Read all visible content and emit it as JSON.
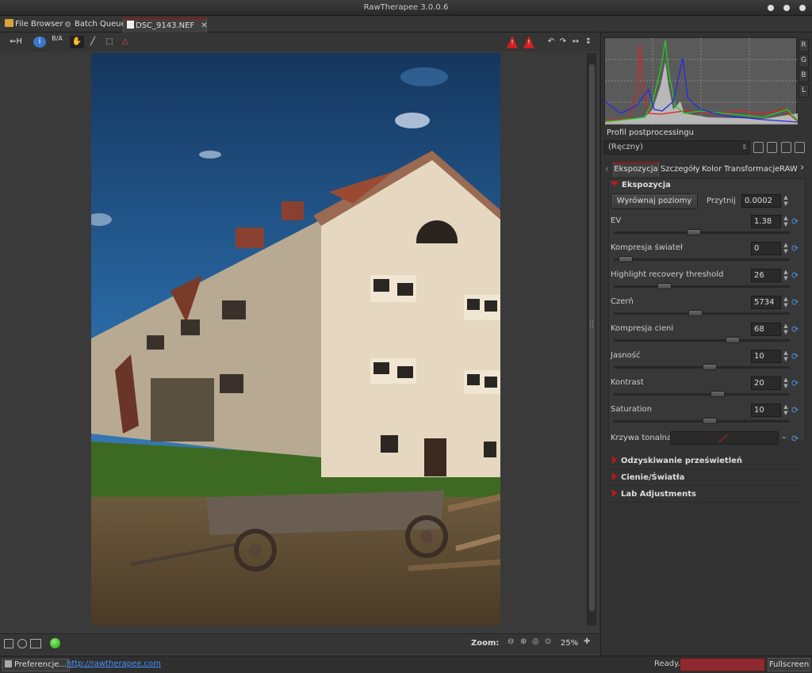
{
  "window": {
    "title": "RawTherapee 3.0.0.6"
  },
  "tabs": [
    {
      "label": "File Browser",
      "icon": "folder-icon"
    },
    {
      "label": "Batch Queue",
      "icon": "gears-icon"
    },
    {
      "label": "DSC_9143.NEF",
      "icon": "file-icon",
      "close": "✕",
      "active": true
    }
  ],
  "toolbar": {
    "history_label": "H",
    "ba_label": "B/A"
  },
  "histogram": {
    "channel_buttons": [
      "R",
      "G",
      "B",
      "L"
    ],
    "colors": {
      "red": "#e02020",
      "green": "#20d020",
      "blue": "#2020e0",
      "luma": "#d8d8d8"
    }
  },
  "profile": {
    "label": "Profil postprocessingu",
    "value": "(Ręczny)"
  },
  "panel_tabs": [
    "Ekspozycja",
    "Szczegóły",
    "Kolor",
    "Transformacje",
    "RAW"
  ],
  "exposure": {
    "title": "Ekspozycja",
    "auto_button": "Wyrównaj poziomy",
    "clip_label": "Przytnij",
    "clip_value": "0.0002",
    "sliders": [
      {
        "label": "EV",
        "value": "1.38",
        "pos": 0.45
      },
      {
        "label": "Kompresja świateł",
        "value": "0",
        "pos": 0.03
      },
      {
        "label": "Highlight recovery threshold",
        "value": "26",
        "pos": 0.27
      },
      {
        "label": "Czerń",
        "value": "5734",
        "pos": 0.46
      },
      {
        "label": "Kompresja cieni",
        "value": "68",
        "pos": 0.69
      },
      {
        "label": "Jasność",
        "value": "10",
        "pos": 0.55
      },
      {
        "label": "Kontrast",
        "value": "20",
        "pos": 0.6
      },
      {
        "label": "Saturation",
        "value": "10",
        "pos": 0.55
      }
    ],
    "curve_label": "Krzywa tonalna:"
  },
  "sections": [
    "Odzyskiwanie prześwietleń",
    "Cienie/Światła",
    "Lab Adjustments"
  ],
  "zoom": {
    "label": "Zoom:",
    "value": "25%"
  },
  "statusbar": {
    "prefs": "Preferencje...",
    "link": "http://rawtherapee.com",
    "ready": "Ready.",
    "fullscreen": "Fullscreen"
  }
}
